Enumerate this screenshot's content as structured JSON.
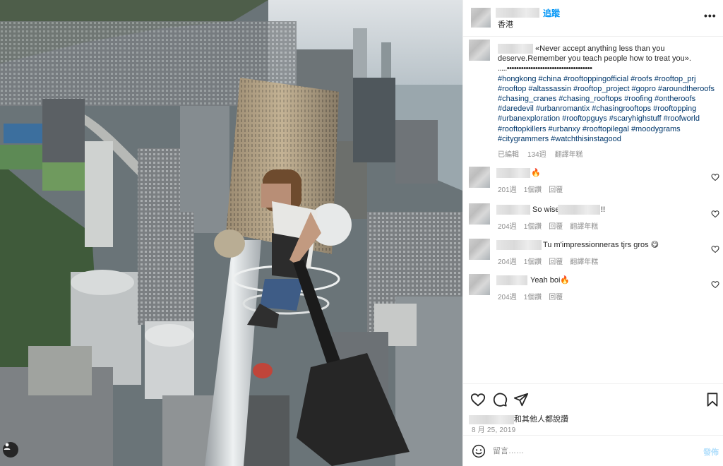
{
  "post": {
    "location": "香港",
    "follow_label": "追蹤",
    "more_label": "•••",
    "caption": {
      "quote": "«Never accept anything less than you deserve.Remember you teach people how to treat you».",
      "dots": ".....••••••••••••••••••••••••••••••••••••",
      "hashtags": "#hongkong #china #rooftoppingofficial #roofs #rooftop_prj #rooftop #altassassin #rooftop_project #gopro #aroundtheroofs #chasing_cranes #chasing_rooftops #roofing #ontheroofs #daredevil #urbanromantix #chasingrooftops #rooftopping #urbanexploration #rooftopguys #scaryhighstuff #roofworld #rooftopkillers #urbanxy #rooftopilegal #moodygrams #citygrammers #watchthisinstagood",
      "edited": "已編輯",
      "age": "134週",
      "translate": "翻譯年糕"
    },
    "comments": [
      {
        "text": "🔥",
        "age": "201週",
        "likes": "1個讚",
        "reply": "回覆",
        "translate": ""
      },
      {
        "text": "So wise",
        "suffix": "!!",
        "age": "204週",
        "likes": "1個讚",
        "reply": "回覆",
        "translate": "翻譯年糕"
      },
      {
        "text": "Tu m'impressionneras tjrs gros 😋",
        "age": "204週",
        "likes": "1個讚",
        "reply": "回覆",
        "translate": "翻譯年糕"
      },
      {
        "text": "Yeah boi🔥",
        "age": "204週",
        "likes": "1個讚",
        "reply": "回覆",
        "translate": ""
      }
    ],
    "likes_text": "和其他人都說讚",
    "date": "8 月 25, 2019",
    "comment_placeholder": "留言……",
    "post_button": "發佈"
  },
  "colors": {
    "accent": "#0095f6",
    "hashtag": "#00376b",
    "secondary_text": "#8e8e8e",
    "post_disabled": "#b2dffc"
  },
  "icons": [
    "user-tag-icon",
    "more-icon",
    "heart-icon",
    "comment-icon",
    "share-icon",
    "bookmark-icon",
    "emoji-icon"
  ]
}
